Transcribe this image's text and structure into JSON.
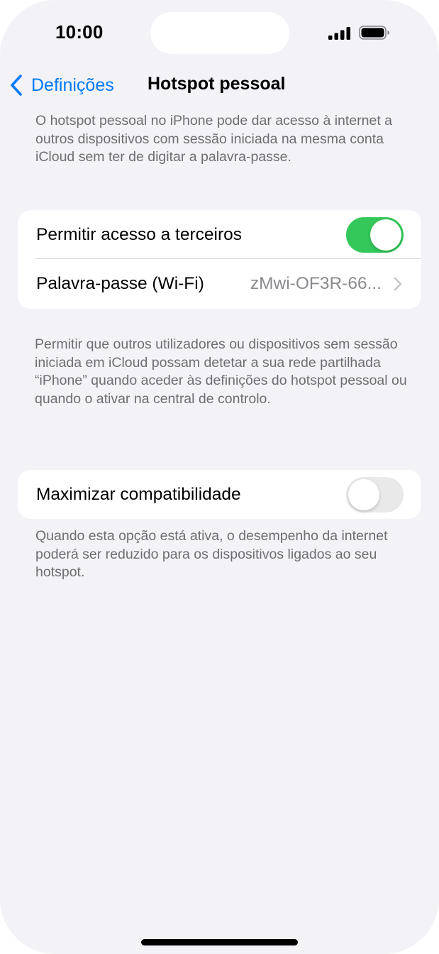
{
  "status_bar": {
    "time": "10:00"
  },
  "nav": {
    "back_label": "Definições",
    "title": "Hotspot pessoal"
  },
  "intro_text": "O hotspot pessoal no iPhone pode dar acesso à internet a outros dispositivos com sessão iniciada na mesma conta iCloud sem ter de digitar a palavra-passe.",
  "group1": {
    "allow_others": {
      "label": "Permitir acesso a terceiros",
      "enabled": true
    },
    "wifi_password": {
      "label": "Palavra-passe (Wi-Fi)",
      "value": "zMwi-OF3R-66..."
    }
  },
  "allow_others_footer": "Permitir que outros utilizadores ou dispositivos sem sessão iniciada em iCloud possam detetar a sua rede partilhada “iPhone” quando aceder às definições do hotspot pessoal ou quando o ativar na central de controlo.",
  "group2": {
    "maximize_compat": {
      "label": "Maximizar compatibilidade",
      "enabled": false
    }
  },
  "maximize_footer": "Quando esta opção está ativa, o desempenho da internet poderá ser reduzido para os dispositivos ligados ao seu hotspot.",
  "colors": {
    "accent": "#007aff",
    "toggle_on": "#34c759",
    "toggle_off": "#e9e9ea",
    "background": "#f2f2f7",
    "secondary_text": "#6d6d72"
  },
  "icons": [
    "chevron-left-icon",
    "signal-icon",
    "battery-icon",
    "chevron-right-icon"
  ]
}
